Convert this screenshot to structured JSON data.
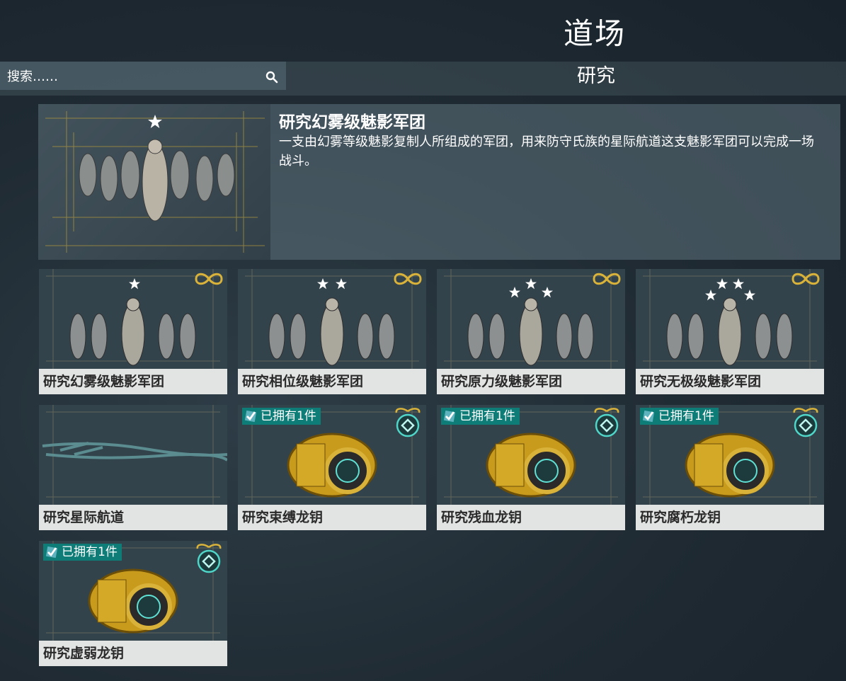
{
  "page": {
    "title": "道场"
  },
  "search": {
    "placeholder": "搜索……"
  },
  "section": {
    "title": "研究"
  },
  "featured": {
    "title": "研究幻雾级魅影军团",
    "description": "一支由幻雾等级魅影复制人所组成的军团，用来防守氏族的星际航道这支魅影军团可以完成一场战斗。",
    "stars": 1
  },
  "tiles": [
    {
      "label": "研究幻雾级魅影军团",
      "stars": 1,
      "corner": "infinity-icon"
    },
    {
      "label": "研究相位级魅影军团",
      "stars": 2,
      "corner": "infinity-icon"
    },
    {
      "label": "研究原力级魅影军团",
      "stars": 3,
      "corner": "infinity-icon"
    },
    {
      "label": "研究无极级魅影军团",
      "stars": 4,
      "corner": "infinity-icon"
    },
    {
      "label": "研究星际航道",
      "stars": 0,
      "corner": ""
    },
    {
      "label": "研究束缚龙钥",
      "owned": "已拥有1件",
      "corner": "dragon-key-icon"
    },
    {
      "label": "研究残血龙钥",
      "owned": "已拥有1件",
      "corner": "dragon-key-icon"
    },
    {
      "label": "研究腐朽龙钥",
      "owned": "已拥有1件",
      "corner": "dragon-key-icon"
    },
    {
      "label": "研究虚弱龙钥",
      "owned": "已拥有1件",
      "corner": "dragon-key-icon"
    }
  ],
  "colors": {
    "gold": "#d9b23a",
    "teal": "#0e7d78",
    "label_bg": "#e2e3e3"
  }
}
